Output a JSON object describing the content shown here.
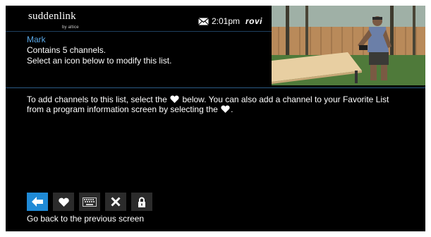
{
  "header": {
    "logo_text": "suddenlink",
    "logo_byline": "by altice",
    "mail_icon": "mail-icon",
    "time": "2:01pm",
    "provider_logo": "rovi"
  },
  "list_info": {
    "name": "Mark",
    "channel_count_text": "Contains 5 channels.",
    "prompt": "Select an icon below to modify this list."
  },
  "instructions": {
    "part1": "To add channels to this list, select the",
    "part2": "below. You can also add a channel to your Favorite List from a program information screen by selecting the",
    "part3": "."
  },
  "toolbar": {
    "buttons": [
      {
        "icon": "back-arrow-icon",
        "active": true
      },
      {
        "icon": "heart-icon",
        "active": false
      },
      {
        "icon": "keyboard-icon",
        "active": false
      },
      {
        "icon": "close-icon",
        "active": false
      },
      {
        "icon": "lock-icon",
        "active": false
      }
    ],
    "caption": "Go back to the previous screen"
  },
  "colors": {
    "accent": "#1f8ad6",
    "name_blue": "#5aa8e6",
    "background": "#000000",
    "button_bg": "#2b2b2b"
  }
}
